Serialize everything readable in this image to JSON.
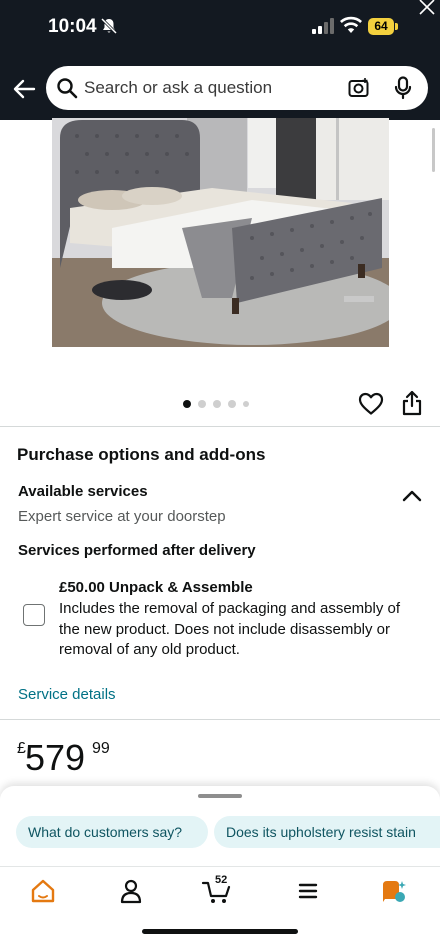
{
  "status_bar": {
    "time": "10:04",
    "battery": "64"
  },
  "header": {
    "search_placeholder": "Search or ask a question"
  },
  "gallery": {
    "image_count": 5,
    "active_index": 0
  },
  "purchase_options": {
    "title": "Purchase options and add-ons",
    "available_label": "Available services",
    "available_sub": "Expert service at your doorstep",
    "after_delivery_label": "Services performed after delivery",
    "service": {
      "title": "£50.00  Unpack & Assemble",
      "description": "Includes the removal of packaging and assembly of the new product. Does not include disassembly or removal of any old product.",
      "checked": false
    },
    "details_link": "Service details"
  },
  "price": {
    "symbol": "£",
    "whole": "579",
    "fraction": "99"
  },
  "suggestions": [
    "What do customers say?",
    "Does its upholstery resist stain"
  ],
  "bottom_nav": {
    "cart_count": "52"
  },
  "colors": {
    "header_bg": "#131921",
    "link": "#007185",
    "chip_bg": "#e3f4f6",
    "home_orange": "#e47911",
    "battery_yellow": "#f3d03e"
  }
}
